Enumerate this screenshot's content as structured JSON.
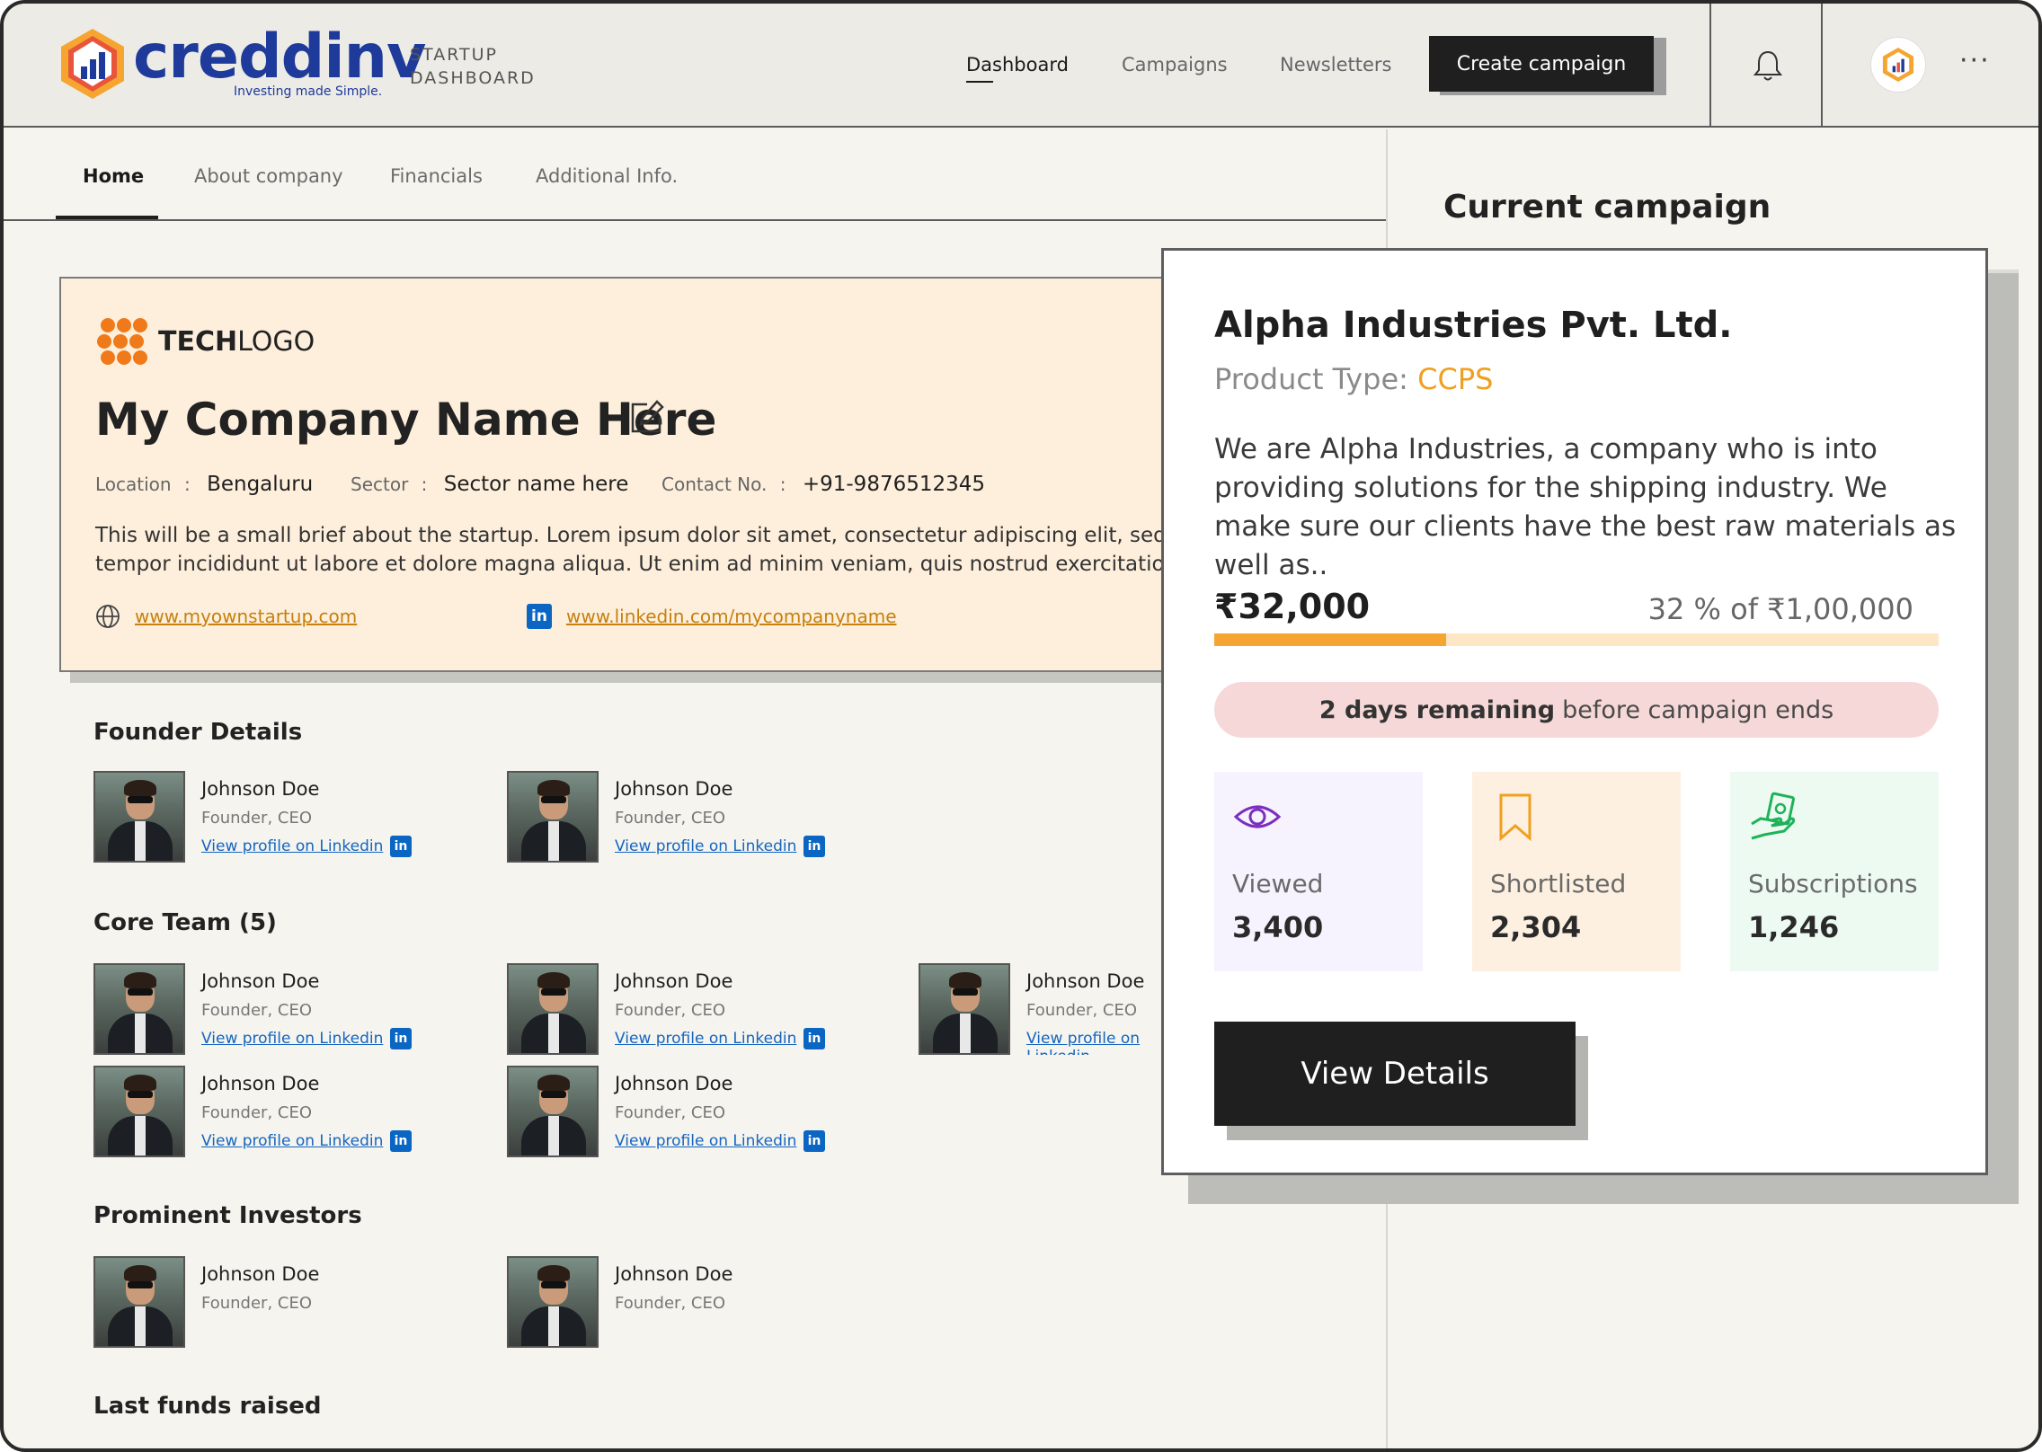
{
  "header": {
    "brand": "creddinv",
    "tagline": "Investing made Simple.",
    "subtitle_line1": "STARTUP",
    "subtitle_line2": "DASHBOARD",
    "nav": [
      {
        "label": "Dashboard",
        "active": true
      },
      {
        "label": "Campaigns",
        "active": false
      },
      {
        "label": "Newsletters",
        "active": false
      }
    ],
    "create_button": "Create campaign",
    "more_label": "···"
  },
  "tabs": [
    {
      "label": "Home",
      "active": true
    },
    {
      "label": "About company",
      "active": false
    },
    {
      "label": "Financials",
      "active": false
    },
    {
      "label": "Additional Info.",
      "active": false
    }
  ],
  "company": {
    "logo_bold": "TECH",
    "logo_light": "LOGO",
    "name": "My Company Name Here",
    "location_label": "Location",
    "location_value": "Bengaluru",
    "sector_label": "Sector",
    "sector_value": "Sector name here",
    "contact_label": "Contact No.",
    "contact_value": "+91-9876512345",
    "separator": ":",
    "brief_line1": "This will be a small brief about the startup. Lorem ipsum dolor sit amet, consectetur adipiscing elit, sed do eiusmod",
    "brief_line2": "tempor incididunt ut labore et dolore magna aliqua. Ut enim ad minim veniam, quis nostrud exercitation ullamco",
    "website": "www.myownstartup.com",
    "linkedin": "www.linkedin.com/mycompanyname"
  },
  "sections": {
    "founders": "Founder Details",
    "core_team": "Core Team (5)",
    "investors": "Prominent Investors",
    "last_funds": "Last funds raised"
  },
  "person": {
    "name": "Johnson Doe",
    "role": "Founder, CEO",
    "link": "View profile on Linkedin",
    "li": "in"
  },
  "right_panel": {
    "title": "Current campaign"
  },
  "campaign": {
    "company": "Alpha Industries Pvt. Ltd.",
    "product_type_label": "Product Type:",
    "product_type_value": "CCPS",
    "description": "We are Alpha Industries, a company who is into providing solutions for the shipping industry. We make sure our clients have the best raw materials as well as..",
    "raised": "₹32,000",
    "progress_text": "32 % of ₹1,00,000",
    "progress_fraction": 0.32,
    "remaining_bold": "2 days remaining",
    "remaining_rest": "before campaign ends",
    "stats": [
      {
        "label": "Viewed",
        "value": "3,400",
        "icon": "eye-icon",
        "bg": "#f6f2fe",
        "color": "#7b2fbe"
      },
      {
        "label": "Shortlisted",
        "value": "2,304",
        "icon": "bookmark-icon",
        "bg": "#fdf0e0",
        "color": "#f0a020"
      },
      {
        "label": "Subscriptions",
        "value": "1,246",
        "icon": "money-hand-icon",
        "bg": "#ecfaf1",
        "color": "#1fb25a"
      }
    ],
    "view_details": "View Details"
  },
  "colors": {
    "accent_orange": "#f5a530",
    "brand_blue": "#1e3a9a",
    "linkedin_blue": "#0a66c2"
  }
}
